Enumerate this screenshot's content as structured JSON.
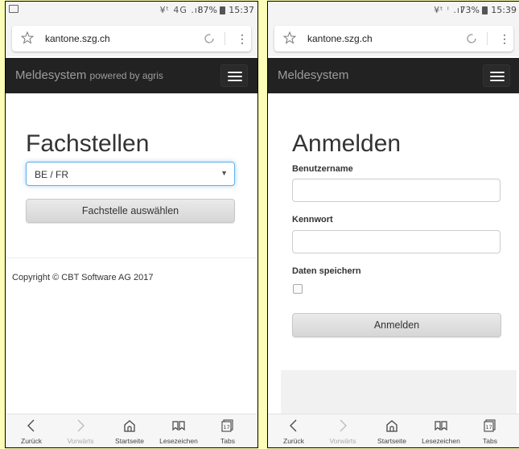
{
  "left": {
    "status": {
      "signal": "¥ᵗ 4G .ıl",
      "battery": "87%",
      "time": "15:37"
    },
    "url": "kantone.szg.ch",
    "nav": {
      "brand": "Meldesystem",
      "brand_sub": "powered by agris"
    },
    "content": {
      "heading": "Fachstellen",
      "select_value": "BE / FR",
      "button_label": "Fachstelle auswählen",
      "copyright": "Copyright © CBT Software AG 2017"
    }
  },
  "right": {
    "status": {
      "signal": "¥ᵗ ⁱ .ıl",
      "battery": "73%",
      "time": "15:39"
    },
    "url": "kantone.szg.ch",
    "nav": {
      "brand": "Meldesystem"
    },
    "content": {
      "heading": "Anmelden",
      "username_label": "Benutzername",
      "password_label": "Kennwort",
      "remember_label": "Daten speichern",
      "button_label": "Anmelden"
    }
  },
  "bottom_nav": [
    {
      "label": "Zurück",
      "icon": "back-arrow-icon",
      "enabled": true
    },
    {
      "label": "Vorwärts",
      "icon": "forward-arrow-icon",
      "enabled": false
    },
    {
      "label": "Startseite",
      "icon": "home-icon",
      "enabled": true
    },
    {
      "label": "Lesezeichen",
      "icon": "bookmarks-icon",
      "enabled": true
    },
    {
      "label": "Tabs",
      "icon": "tabs-icon",
      "tabs_count": "17",
      "enabled": true
    }
  ]
}
